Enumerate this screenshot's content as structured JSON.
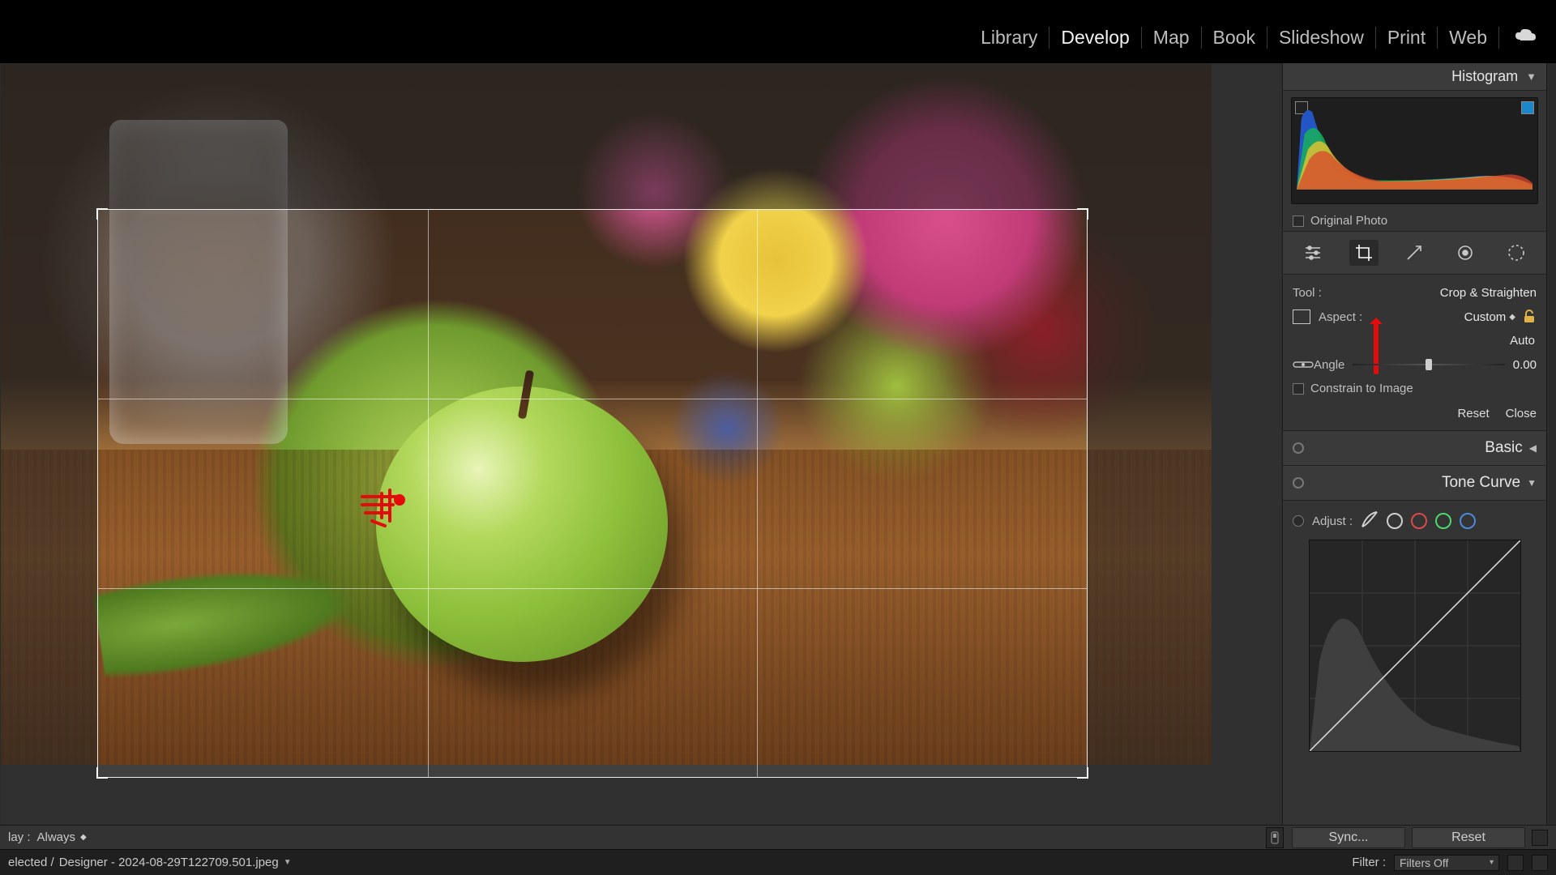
{
  "modules": {
    "library": "Library",
    "develop": "Develop",
    "map": "Map",
    "book": "Book",
    "slideshow": "Slideshow",
    "print": "Print",
    "web": "Web",
    "active": "develop"
  },
  "histogram": {
    "title": "Histogram"
  },
  "original_photo_label": "Original Photo",
  "crop_tool": {
    "tool_label": "Tool :",
    "tool_name": "Crop & Straighten",
    "aspect_label": "Aspect :",
    "aspect_value": "Custom",
    "auto_label": "Auto",
    "angle_label": "Angle",
    "angle_value": "0.00",
    "constrain_label": "Constrain to Image",
    "reset_label": "Reset",
    "close_label": "Close"
  },
  "sections": {
    "basic": "Basic",
    "tone_curve": "Tone Curve"
  },
  "tone_curve": {
    "adjust_label": "Adjust :",
    "channels": [
      {
        "name": "parametric",
        "stroke": "#cfcfcf"
      },
      {
        "name": "point",
        "stroke": "#cfcfcf"
      },
      {
        "name": "red",
        "stroke": "#d94a4a"
      },
      {
        "name": "green",
        "stroke": "#4ad96a"
      },
      {
        "name": "blue",
        "stroke": "#4a8ad9"
      }
    ]
  },
  "footer": {
    "play_label": "lay :",
    "play_value": "Always",
    "sync_label": "Sync...",
    "reset_label": "Reset",
    "selected_label": "elected /",
    "filename": "Designer - 2024-08-29T122709.501.jpeg",
    "filter_label": "Filter :",
    "filter_value": "Filters Off"
  },
  "colors": {
    "accent_red": "#e30b0b"
  }
}
